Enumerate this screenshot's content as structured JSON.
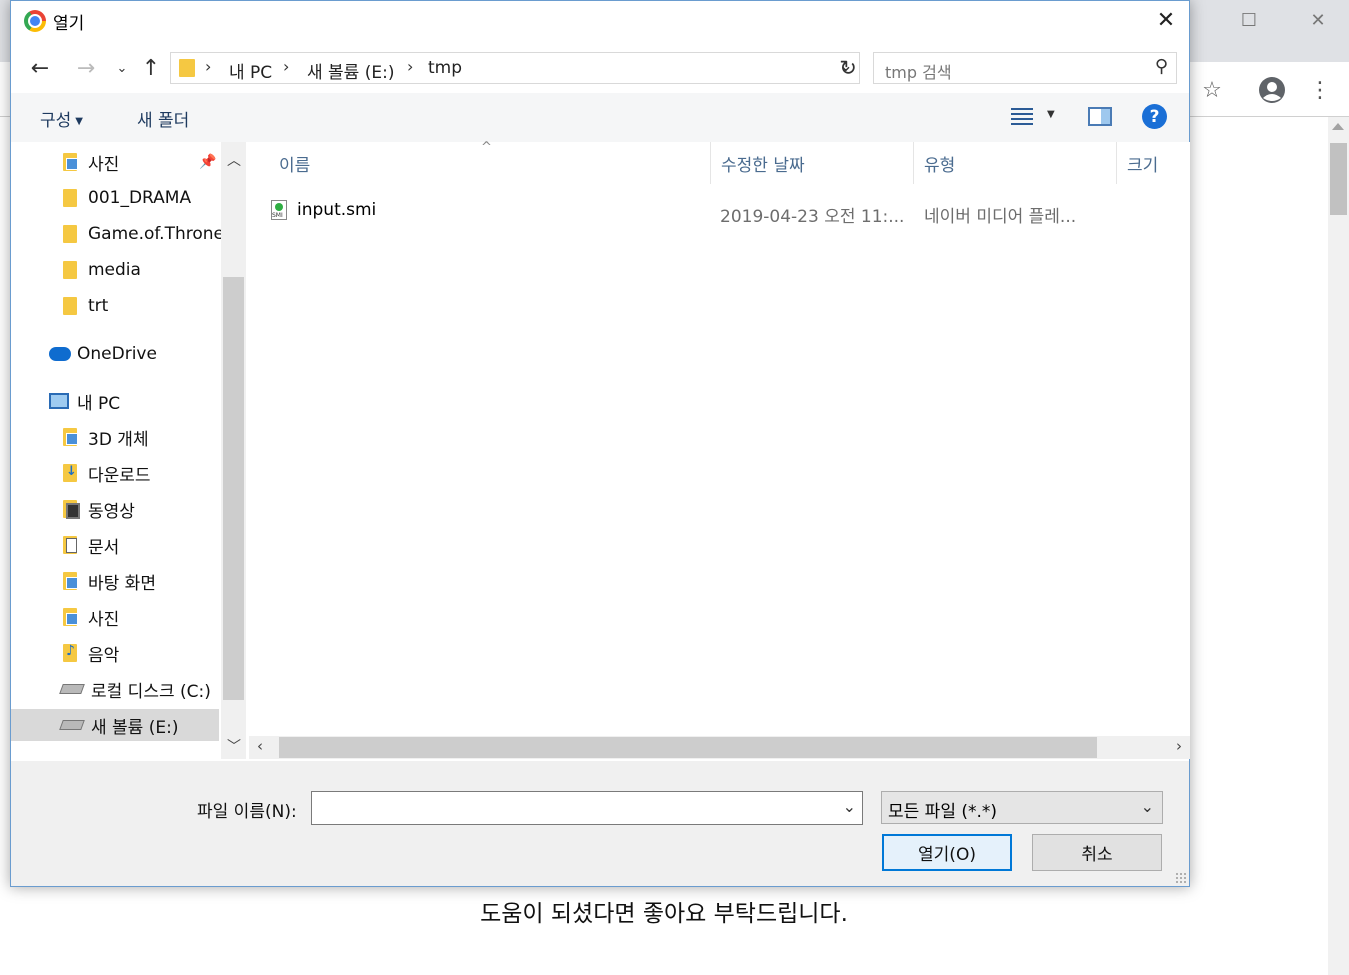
{
  "browser": {
    "minimize_icon": "maximize-icon",
    "close_icon": "close-icon",
    "bottom_text": "도움이 되셨다면 좋아요 부탁드립니다."
  },
  "dialog": {
    "title": "열기",
    "path": [
      "내 PC",
      "새 볼륨 (E:)",
      "tmp"
    ],
    "search_placeholder": "tmp 검색",
    "toolbar": {
      "organize": "구성",
      "new_folder": "새 폴더"
    }
  },
  "sidebar": {
    "items": [
      {
        "label": "사진",
        "icon": "pictures-folder-icon",
        "pinned": true
      },
      {
        "label": "001_DRAMA",
        "icon": "folder-icon"
      },
      {
        "label": "Game.of.Throne",
        "icon": "folder-icon"
      },
      {
        "label": "media",
        "icon": "folder-icon"
      },
      {
        "label": "trt",
        "icon": "folder-icon"
      },
      {
        "label": "OneDrive",
        "icon": "onedrive-icon"
      },
      {
        "label": "내 PC",
        "icon": "pc-icon"
      },
      {
        "label": "3D 개체",
        "icon": "3d-objects-folder-icon"
      },
      {
        "label": "다운로드",
        "icon": "downloads-folder-icon"
      },
      {
        "label": "동영상",
        "icon": "videos-folder-icon"
      },
      {
        "label": "문서",
        "icon": "documents-folder-icon"
      },
      {
        "label": "바탕 화면",
        "icon": "desktop-folder-icon"
      },
      {
        "label": "사진",
        "icon": "pictures-folder-icon"
      },
      {
        "label": "음악",
        "icon": "music-folder-icon"
      },
      {
        "label": "로컬 디스크 (C:)",
        "icon": "local-disk-icon"
      },
      {
        "label": "새 볼륨 (E:)",
        "icon": "drive-icon",
        "selected": true
      }
    ]
  },
  "columns": {
    "name": "이름",
    "date": "수정한 날짜",
    "type": "유형",
    "size": "크기"
  },
  "files": [
    {
      "name": "input.smi",
      "date": "2019-04-23 오전 11:...",
      "type": "네이버 미디어 플레..."
    }
  ],
  "footer": {
    "filename_label": "파일 이름(N):",
    "filename_value": "",
    "filetype": "모든 파일 (*.*)",
    "open_button": "열기(O)",
    "cancel_button": "취소"
  }
}
